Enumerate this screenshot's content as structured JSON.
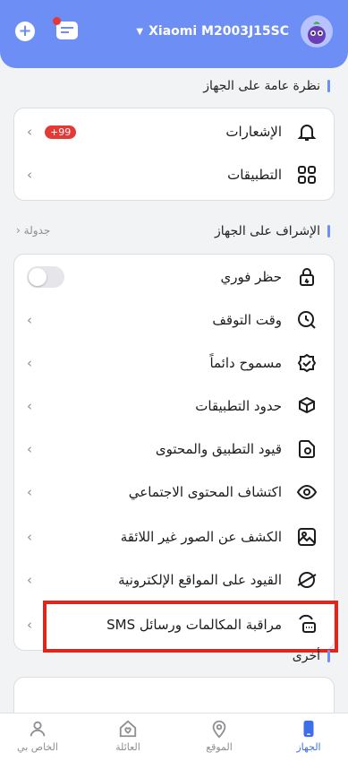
{
  "header": {
    "device_name": "Xiaomi M2003J15SC",
    "icons": [
      "plus-icon",
      "message-icon",
      "dropdown-icon",
      "avatar"
    ]
  },
  "sections": {
    "overview": {
      "title": "نظرة عامة على الجهاز",
      "items": [
        {
          "label": "الإشعارات",
          "icon": "bell-icon",
          "badge": "+99"
        },
        {
          "label": "التطبيقات",
          "icon": "apps-grid-icon"
        }
      ]
    },
    "supervision": {
      "title": "الإشراف على الجهاز",
      "schedule_link": "جدولة",
      "items": [
        {
          "label": "حظر فوري",
          "icon": "lock-icon",
          "toggle": false
        },
        {
          "label": "وقت التوقف",
          "icon": "clock-icon"
        },
        {
          "label": "مسموح دائماً",
          "icon": "shield-check-icon"
        },
        {
          "label": "حدود التطبيقات",
          "icon": "box-timer-icon"
        },
        {
          "label": "قيود التطبيق والمحتوى",
          "icon": "settings-doc-icon"
        },
        {
          "label": "اكتشاف المحتوى الاجتماعي",
          "icon": "eye-icon"
        },
        {
          "label": "الكشف عن الصور غير اللائقة",
          "icon": "image-icon"
        },
        {
          "label": "القيود على المواقع الإلكترونية",
          "icon": "globe-icon"
        },
        {
          "label": "مراقبة المكالمات ورسائل SMS",
          "icon": "call-message-icon"
        }
      ]
    },
    "other": {
      "title": "أخرى"
    }
  },
  "tabbar": {
    "tabs": [
      {
        "label": "الجهاز",
        "icon": "phone-icon",
        "active": true
      },
      {
        "label": "الموقع",
        "icon": "location-icon",
        "active": false
      },
      {
        "label": "العائلة",
        "icon": "family-icon",
        "active": false
      },
      {
        "label": "الخاص بي",
        "icon": "profile-icon",
        "active": false
      }
    ]
  },
  "colors": {
    "accent": "#6c8ef5",
    "badge": "#e53935",
    "highlight": "#e0251b",
    "active_tab": "#3f6fe8"
  }
}
